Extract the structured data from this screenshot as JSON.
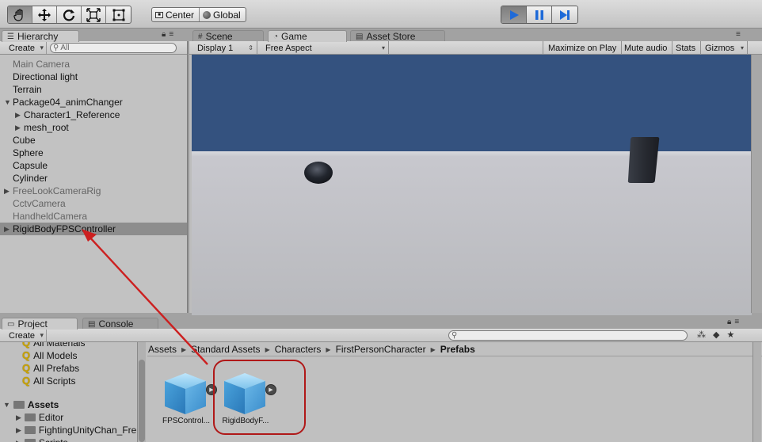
{
  "toolbar": {
    "transform_tools": [
      "hand-tool-icon",
      "move-tool-icon",
      "rotate-tool-icon",
      "scale-tool-icon",
      "rect-tool-icon"
    ],
    "pivot_label": "Center",
    "space_label": "Global",
    "play_controls": [
      "play-icon",
      "pause-icon",
      "step-icon"
    ],
    "play_accent": "#1e6ad8"
  },
  "hierarchy": {
    "tab_label": "Hierarchy",
    "create_label": "Create",
    "search_placeholder": "All",
    "items": [
      {
        "label": "Main Camera",
        "indent": 0,
        "style": "grey",
        "arrow": ""
      },
      {
        "label": "Directional light",
        "indent": 0,
        "style": "normal",
        "arrow": ""
      },
      {
        "label": "Terrain",
        "indent": 0,
        "style": "normal",
        "arrow": ""
      },
      {
        "label": "Package04_animChanger",
        "indent": 0,
        "style": "normal",
        "arrow": "down"
      },
      {
        "label": "Character1_Reference",
        "indent": 1,
        "style": "normal",
        "arrow": "right"
      },
      {
        "label": "mesh_root",
        "indent": 1,
        "style": "normal",
        "arrow": "right"
      },
      {
        "label": "Cube",
        "indent": 0,
        "style": "normal",
        "arrow": ""
      },
      {
        "label": "Sphere",
        "indent": 0,
        "style": "normal",
        "arrow": ""
      },
      {
        "label": "Capsule",
        "indent": 0,
        "style": "normal",
        "arrow": ""
      },
      {
        "label": "Cylinder",
        "indent": 0,
        "style": "normal",
        "arrow": ""
      },
      {
        "label": "FreeLookCameraRig",
        "indent": 0,
        "style": "grey",
        "arrow": "right"
      },
      {
        "label": "CctvCamera",
        "indent": 0,
        "style": "grey",
        "arrow": ""
      },
      {
        "label": "HandheldCamera",
        "indent": 0,
        "style": "grey",
        "arrow": ""
      },
      {
        "label": "RigidBodyFPSController",
        "indent": 0,
        "style": "selected",
        "arrow": "right"
      }
    ]
  },
  "center_tabs": {
    "scene": "Scene",
    "game": "Game",
    "asset_store": "Asset Store"
  },
  "game_bar": {
    "display": "Display 1",
    "aspect": "Free Aspect",
    "maximize": "Maximize on Play",
    "mute": "Mute audio",
    "stats": "Stats",
    "gizmos": "Gizmos"
  },
  "game_view_colors": {
    "sky": "#34527f",
    "ground": "#c4c5ca"
  },
  "bottom_tabs": {
    "project": "Project",
    "console": "Console"
  },
  "project": {
    "create_label": "Create",
    "search_placeholder": "",
    "favorites": [
      "All Materials",
      "All Models",
      "All Prefabs",
      "All Scripts"
    ],
    "assets_root": "Assets",
    "folders": [
      "Editor",
      "FightingUnityChan_Fre",
      "Scripts"
    ],
    "breadcrumb": [
      "Assets",
      "Standard Assets",
      "Characters",
      "FirstPersonCharacter",
      "Prefabs"
    ],
    "prefabs": [
      {
        "label": "FPSControl..."
      },
      {
        "label": "RigidBodyF..."
      }
    ]
  },
  "annotation": {
    "arrow_color": "#cc2020",
    "highlight_color": "#b01818"
  }
}
